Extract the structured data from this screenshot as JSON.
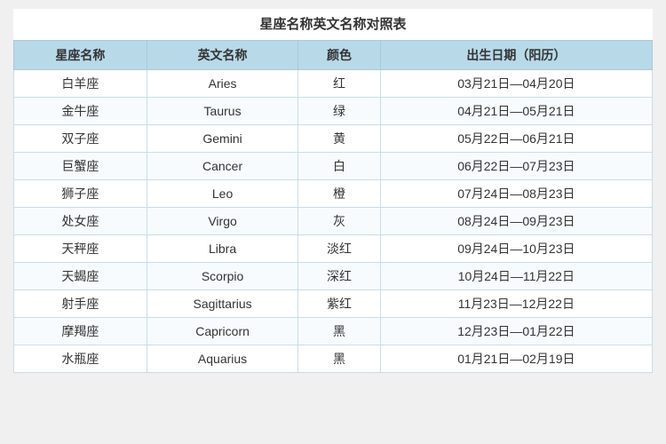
{
  "title": "星座名称英文名称对照表",
  "columns": [
    "星座名称",
    "英文名称",
    "颜色",
    "出生日期（阳历）"
  ],
  "rows": [
    {
      "chinese": "白羊座",
      "english": "Aries",
      "color": "红",
      "dates": "03月21日—04月20日"
    },
    {
      "chinese": "金牛座",
      "english": "Taurus",
      "color": "绿",
      "dates": "04月21日—05月21日"
    },
    {
      "chinese": "双子座",
      "english": "Gemini",
      "color": "黄",
      "dates": "05月22日—06月21日"
    },
    {
      "chinese": "巨蟹座",
      "english": "Cancer",
      "color": "白",
      "dates": "06月22日—07月23日"
    },
    {
      "chinese": "狮子座",
      "english": "Leo",
      "color": "橙",
      "dates": "07月24日—08月23日"
    },
    {
      "chinese": "处女座",
      "english": "Virgo",
      "color": "灰",
      "dates": "08月24日—09月23日"
    },
    {
      "chinese": "天秤座",
      "english": "Libra",
      "color": "淡红",
      "dates": "09月24日—10月23日"
    },
    {
      "chinese": "天蝎座",
      "english": "Scorpio",
      "color": "深红",
      "dates": "10月24日—11月22日"
    },
    {
      "chinese": "射手座",
      "english": "Sagittarius",
      "color": "紫红",
      "dates": "11月23日—12月22日"
    },
    {
      "chinese": "摩羯座",
      "english": "Capricorn",
      "color": "黑",
      "dates": "12月23日—01月22日"
    },
    {
      "chinese": "水瓶座",
      "english": "Aquarius",
      "color": "黑",
      "dates": "01月21日—02月19日"
    }
  ]
}
